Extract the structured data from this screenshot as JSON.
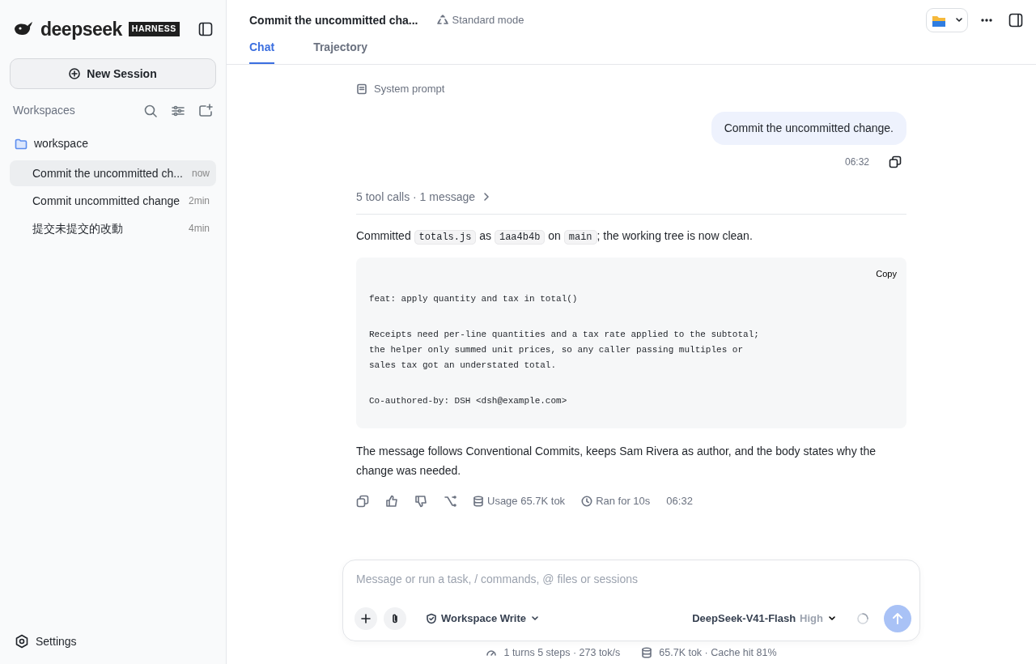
{
  "sidebar": {
    "logo": "deepseek",
    "logo_badge": "HARNESS",
    "new_session": "New Session",
    "section_title": "Workspaces",
    "workspaces": [
      {
        "name": "workspace",
        "sessions": [
          {
            "title": "Commit the uncommitted ch...",
            "time": "now",
            "selected": true
          },
          {
            "title": "Commit uncommitted change",
            "time": "2min",
            "selected": false
          },
          {
            "title": "提交未提交的改動",
            "time": "4min",
            "selected": false
          }
        ]
      }
    ],
    "settings": "Settings"
  },
  "header": {
    "title": "Commit the uncommitted cha...",
    "mode": "Standard mode",
    "tabs": [
      {
        "label": "Chat",
        "selected": true
      },
      {
        "label": "Trajectory",
        "selected": false
      }
    ]
  },
  "chat": {
    "system_prompt": "System prompt",
    "user_message": {
      "text": "Commit the uncommitted change.",
      "time": "06:32"
    },
    "tool_summary": "5 tool calls · 1 message",
    "reply_intro": [
      {
        "kind": "text",
        "text": "Committed "
      },
      {
        "kind": "code",
        "text": "totals.js"
      },
      {
        "kind": "text",
        "text": " as "
      },
      {
        "kind": "code",
        "text": "1aa4b4b"
      },
      {
        "kind": "text",
        "text": " on "
      },
      {
        "kind": "code",
        "text": "main"
      },
      {
        "kind": "text",
        "text": "; the working tree is now clean."
      }
    ],
    "code_block": {
      "copy": "Copy",
      "paragraphs": [
        {
          "lines": [
            "feat: apply quantity and tax in total()"
          ]
        },
        {
          "lines": [
            "Receipts need per-line quantities and a tax rate applied to the subtotal;",
            "the helper only summed unit prices, so any caller passing multiples or",
            "sales tax got an understated total."
          ]
        },
        {
          "lines": [
            "Co-authored-by: DSH <dsh@example.com>"
          ]
        }
      ]
    },
    "reply_outro": "The message follows Conventional Commits, keeps Sam Rivera as author, and the body states why the change was needed.",
    "usage": "Usage 65.7K tok",
    "duration": "Ran for 10s",
    "time": "06:32"
  },
  "composer": {
    "placeholder": "Message or run a task, / commands, @ files or sessions",
    "permission": "Workspace Write",
    "model": "DeepSeek-V41-Flash",
    "effort": "High"
  },
  "status": {
    "speed": "1 turns 5 steps · 273 tok/s",
    "tokens": "65.7K tok · Cache hit 81%"
  }
}
